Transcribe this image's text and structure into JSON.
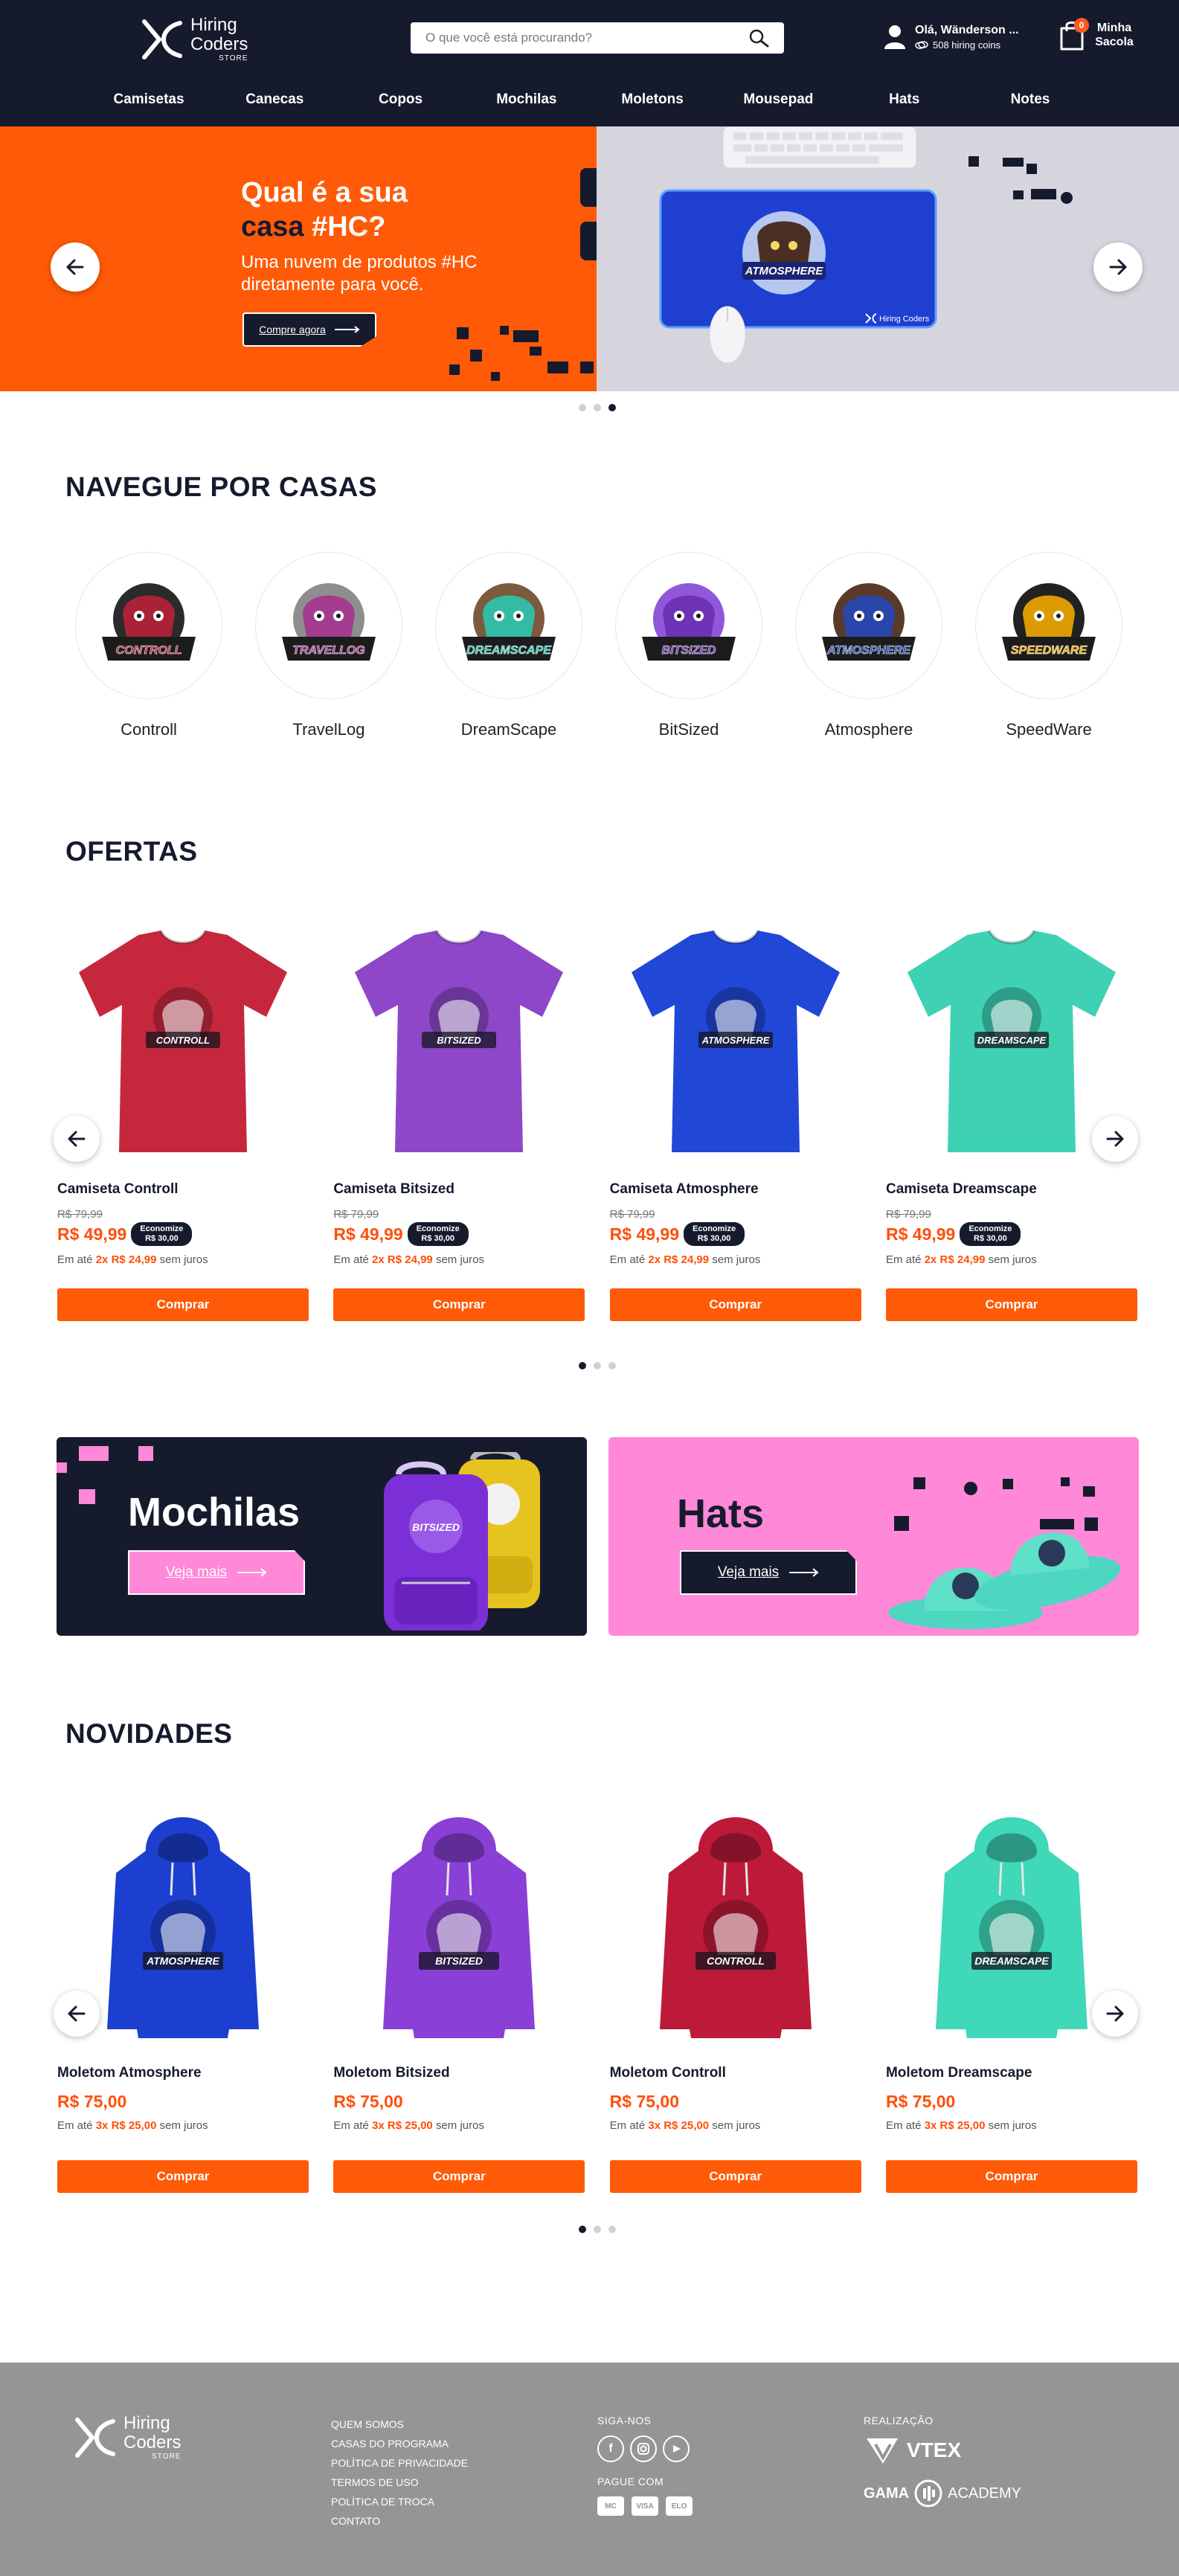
{
  "header": {
    "logo": {
      "line1": "Hiring",
      "line2": "Coders",
      "line3": "STORE"
    },
    "search_placeholder": "O que você está procurando?",
    "user": {
      "greeting": "Olá, Wänderson ...",
      "coins": "508 hiring coins"
    },
    "bag": {
      "count": "0",
      "label": "Minha Sacola"
    },
    "nav": [
      "Camisetas",
      "Canecas",
      "Copos",
      "Mochilas",
      "Moletons",
      "Mousepad",
      "Hats",
      "Notes"
    ]
  },
  "hero": {
    "title_line1": "Qual é a sua",
    "title_word_dark": "casa",
    "title_tag": "#HC?",
    "subtitle": "Uma nuvem de produtos #HC diretamente para você.",
    "cta": "Compre agora",
    "mousepad_label": "Hiring Coders",
    "mousepad_emblem": "ATMOSPHERE"
  },
  "houses_section": {
    "title": "NAVEGUE POR CASAS",
    "items": [
      {
        "name": "Controll",
        "emblem": "CONTROLL",
        "color": "#b8213a",
        "bg": "#2b2b2b"
      },
      {
        "name": "TravelLog",
        "emblem": "TRAVELLOG",
        "color": "#a5338f",
        "bg": "#8e8e8e"
      },
      {
        "name": "DreamScape",
        "emblem": "DREAMSCAPE",
        "color": "#2cc5b0",
        "bg": "#7d5a3c"
      },
      {
        "name": "BitSized",
        "emblem": "BITSIZED",
        "color": "#6b2fb3",
        "bg": "#8f57d9"
      },
      {
        "name": "Atmosphere",
        "emblem": "ATMOSPHERE",
        "color": "#2348b8",
        "bg": "#5a3a2a"
      },
      {
        "name": "SpeedWare",
        "emblem": "SPEEDWARE",
        "color": "#f2a900",
        "bg": "#222222"
      }
    ]
  },
  "offers_section": {
    "title": "OFERTAS",
    "products": [
      {
        "name": "Camiseta Controll",
        "old_price": "R$ 79,99",
        "price": "R$ 49,99",
        "econ_label": "Economize",
        "econ_value": "R$ 30,00",
        "inst_prefix": "Em até",
        "inst_times": "2x",
        "inst_value": "R$ 24,99",
        "inst_suffix": "sem juros",
        "buy": "Comprar",
        "color": "#c5283d",
        "emblem": "CONTROLL"
      },
      {
        "name": "Camiseta Bitsized",
        "old_price": "R$ 79,99",
        "price": "R$ 49,99",
        "econ_label": "Economize",
        "econ_value": "R$ 30,00",
        "inst_prefix": "Em até",
        "inst_times": "2x",
        "inst_value": "R$ 24,99",
        "inst_suffix": "sem juros",
        "buy": "Comprar",
        "color": "#8d47c8",
        "emblem": "BITSIZED"
      },
      {
        "name": "Camiseta Atmosphere",
        "old_price": "R$ 79,99",
        "price": "R$ 49,99",
        "econ_label": "Economize",
        "econ_value": "R$ 30,00",
        "inst_prefix": "Em até",
        "inst_times": "2x",
        "inst_value": "R$ 24,99",
        "inst_suffix": "sem juros",
        "buy": "Comprar",
        "color": "#2147d6",
        "emblem": "ATMOSPHERE"
      },
      {
        "name": "Camiseta Dreamscape",
        "old_price": "R$ 79,99",
        "price": "R$ 49,99",
        "econ_label": "Economize",
        "econ_value": "R$ 30,00",
        "inst_prefix": "Em até",
        "inst_times": "2x",
        "inst_value": "R$ 24,99",
        "inst_suffix": "sem juros",
        "buy": "Comprar",
        "color": "#3fd1b4",
        "emblem": "DREAMSCAPE"
      }
    ]
  },
  "promos": {
    "mochilas": {
      "title": "Mochilas",
      "cta": "Veja mais"
    },
    "hats": {
      "title": "Hats",
      "cta": "Veja mais"
    }
  },
  "news_section": {
    "title": "NOVIDADES",
    "products": [
      {
        "name": "Moletom Atmosphere",
        "price": "R$ 75,00",
        "inst_prefix": "Em até",
        "inst_times": "3x",
        "inst_value": "R$ 25,00",
        "inst_suffix": "sem juros",
        "buy": "Comprar",
        "color": "#1c3fd0",
        "emblem": "ATMOSPHERE"
      },
      {
        "name": "Moletom Bitsized",
        "price": "R$ 75,00",
        "inst_prefix": "Em até",
        "inst_times": "3x",
        "inst_value": "R$ 25,00",
        "inst_suffix": "sem juros",
        "buy": "Comprar",
        "color": "#8a3fd6",
        "emblem": "BITSIZED"
      },
      {
        "name": "Moletom Controll",
        "price": "R$ 75,00",
        "inst_prefix": "Em até",
        "inst_times": "3x",
        "inst_value": "R$ 25,00",
        "inst_suffix": "sem juros",
        "buy": "Comprar",
        "color": "#bd1a3a",
        "emblem": "CONTROLL"
      },
      {
        "name": "Moletom Dreamscape",
        "price": "R$ 75,00",
        "inst_prefix": "Em até",
        "inst_times": "3x",
        "inst_value": "R$ 25,00",
        "inst_suffix": "sem juros",
        "buy": "Comprar",
        "color": "#3fd8b8",
        "emblem": "DREAMSCAPE"
      }
    ]
  },
  "footer": {
    "links": [
      "QUEM SOMOS",
      "CASAS DO PROGRAMA",
      "POLÍTICA DE PRIVACIDADE",
      "TERMOS DE USO",
      "POLÍTICA DE TROCA",
      "CONTATO"
    ],
    "follow_title": "SIGA-NOS",
    "pay_title": "PAGUE COM",
    "pay_methods": [
      "MC",
      "VISA",
      "ELO"
    ],
    "made_by_title": "REALIZAÇÃO",
    "vtex": "VTEX",
    "gama": "GAMA",
    "academy": "ACADEMY"
  },
  "colors": {
    "navy": "#151b2d",
    "orange": "#ff5a07",
    "pink": "#ff88d8",
    "footer": "#959595"
  }
}
